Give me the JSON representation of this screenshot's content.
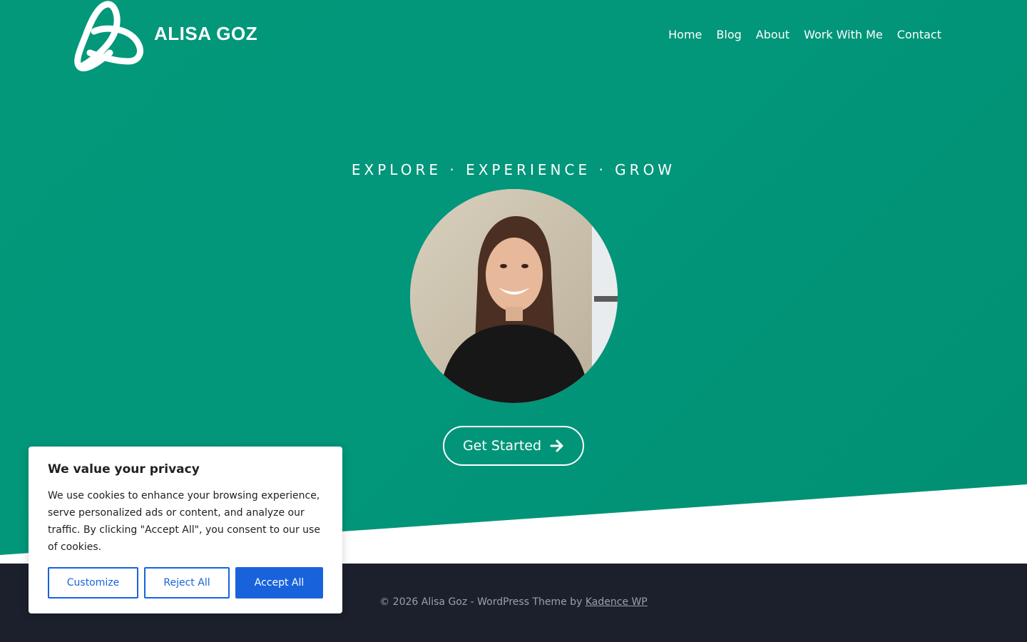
{
  "header": {
    "site_title": "ALISA GOZ",
    "nav": [
      "Home",
      "Blog",
      "About",
      "Work With Me",
      "Contact"
    ]
  },
  "hero": {
    "tagline": "EXPLORE · EXPERIENCE · GROW",
    "cta_label": "Get Started",
    "cta_icon": "arrow-right-icon"
  },
  "cookie_banner": {
    "title": "We value your privacy",
    "body": "We use cookies to enhance your browsing experience, serve personalized ads or content, and analyze our traffic. By clicking \"Accept All\", you consent to our use of cookies.",
    "customize_label": "Customize",
    "reject_label": "Reject All",
    "accept_label": "Accept All"
  },
  "footer": {
    "copyright": "© 2026 Alisa Goz - WordPress Theme by ",
    "credit_link": "Kadence WP"
  },
  "colors": {
    "hero_green": "#039879",
    "footer_bg": "#1c202c",
    "accent_blue": "#1863dc"
  }
}
